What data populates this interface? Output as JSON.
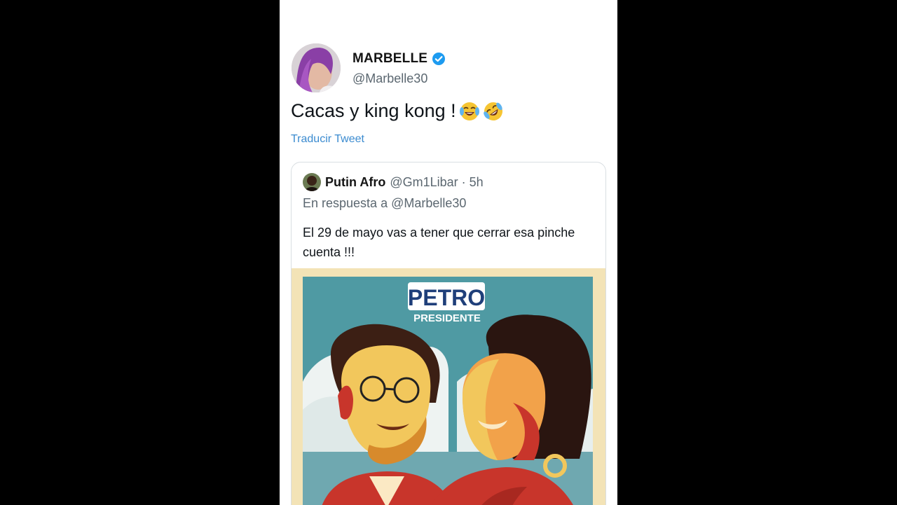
{
  "tweet": {
    "display_name": "MARBELLE",
    "handle": "@Marbelle30",
    "text": "Cacas y king kong !",
    "emojis": [
      "face-with-tears-of-joy",
      "rolling-on-the-floor-laughing"
    ],
    "translate_label": "Traducir Tweet"
  },
  "quoted_tweet": {
    "display_name": "Putin Afro",
    "handle": "@Gm1Libar",
    "separator": "·",
    "time": "5h",
    "reply_prefix": "En respuesta a",
    "reply_to": "@Marbelle30",
    "text": "El 29 de mayo vas a tener que cerrar esa pinche cuenta !!!",
    "poster": {
      "logo_text": "PETRO",
      "subtitle": "PRESIDENTE"
    }
  },
  "colors": {
    "verified_badge": "#1d9bf0",
    "link": "#3b8bd0",
    "poster_sky": "#4f9aa3",
    "poster_red": "#c8352b",
    "poster_yellow": "#f2c75c"
  }
}
